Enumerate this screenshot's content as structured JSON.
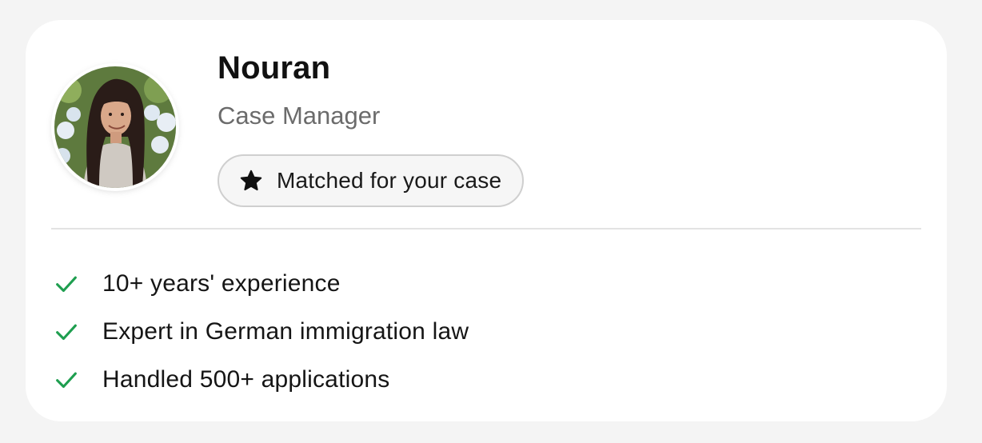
{
  "profile": {
    "name": "Nouran",
    "role": "Case Manager",
    "avatar_alt": "Nouran",
    "badge": {
      "icon": "star-icon",
      "label": "Matched for your case"
    }
  },
  "features": [
    {
      "icon": "check-icon",
      "text": "10+ years' experience"
    },
    {
      "icon": "check-icon",
      "text": "Expert in German immigration law"
    },
    {
      "icon": "check-icon",
      "text": "Handled 500+ applications"
    }
  ],
  "colors": {
    "page_background": "#f4f4f4",
    "card_background": "#ffffff",
    "check_color": "#1e9e4f",
    "name_color": "#111111",
    "role_color": "#6b6b6b"
  }
}
